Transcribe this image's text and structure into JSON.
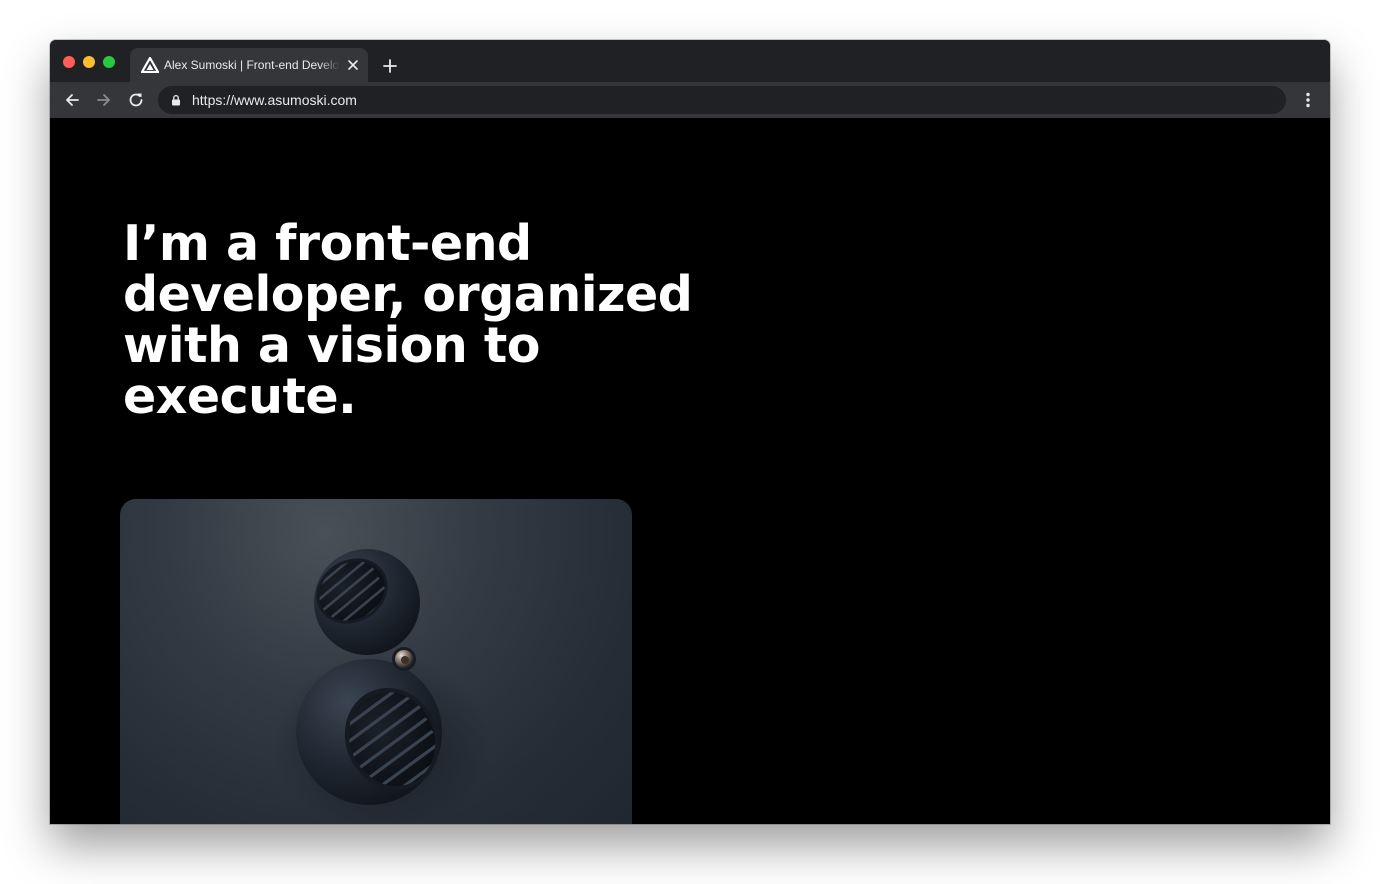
{
  "browser": {
    "tab": {
      "title": "Alex Sumoski | Front-end Developer",
      "favicon": "triangle-logo-icon"
    },
    "address_bar": {
      "url": "https://www.asumoski.com"
    },
    "controls": {
      "back": "back-arrow-icon",
      "forward": "forward-arrow-icon",
      "reload": "reload-icon",
      "new_tab": "plus-icon",
      "menu": "kebab-menu-icon",
      "close_tab": "close-icon",
      "lock": "lock-icon"
    }
  },
  "page": {
    "headline": "I’m a front-end developer, organized with a vision to execute.",
    "hero_image": "stacked-spheres-speaker-render"
  },
  "colors": {
    "page_background": "#000000",
    "headline_text": "#ffffff",
    "chrome_tabstrip": "#202124",
    "chrome_toolbar": "#35363a"
  }
}
